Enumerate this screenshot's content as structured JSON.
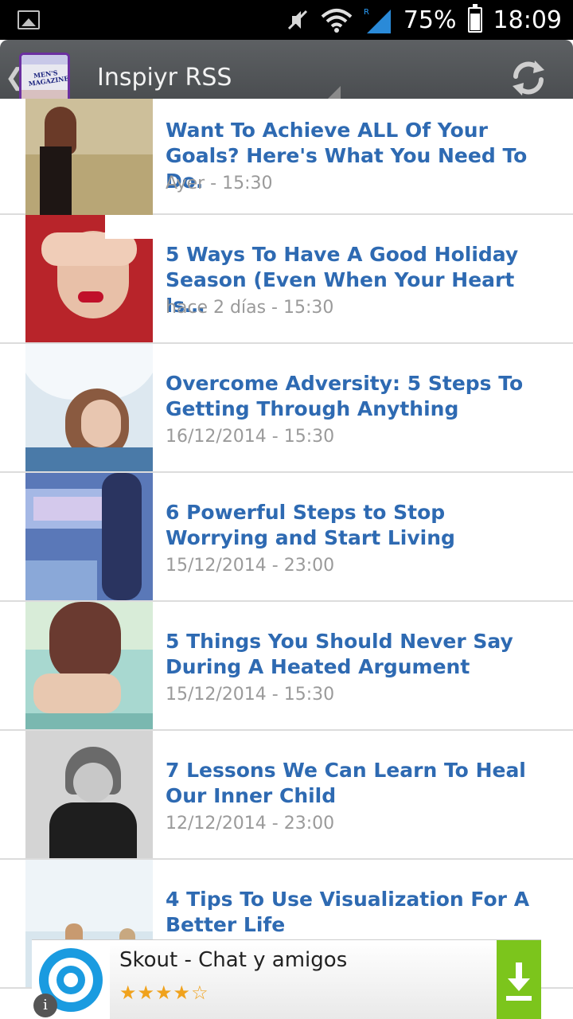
{
  "status_bar": {
    "battery_percent_text": "75%",
    "battery_level": 0.75,
    "time": "18:09",
    "icons": [
      "gallery-icon",
      "mute-icon",
      "wifi-icon",
      "signal-icon",
      "battery-icon"
    ]
  },
  "action_bar": {
    "title": "Inspiyr RSS",
    "logo_text": "MEN'S MAGAZINES",
    "icons": [
      "back-icon",
      "refresh-icon",
      "overflow-spinner-icon"
    ]
  },
  "feed": {
    "items": [
      {
        "title": "Want To Achieve ALL Of Your Goals? Here's What You Need To Do.",
        "date": "Ayer - 15:30",
        "thumb_colors": [
          "#cdbf9a",
          "#8a7b55",
          "#3a2a24"
        ]
      },
      {
        "title": "5 Ways To Have A Good Holiday Season (Even When Your Heart Is…",
        "date": "hace 2 días - 15:30",
        "thumb_colors": [
          "#c0282a",
          "#e8c0a8",
          "#ffffff"
        ]
      },
      {
        "title": "Overcome Adversity: 5 Steps To Getting Through Anything",
        "date": "16/12/2014 - 15:30",
        "thumb_colors": [
          "#cfdde8",
          "#8a5a40",
          "#2a5a8a"
        ]
      },
      {
        "title": "6 Powerful Steps to Stop Worrying and Start Living",
        "date": "15/12/2014 - 23:00",
        "thumb_colors": [
          "#4a6ab0",
          "#c0b8e0",
          "#2a3a6a"
        ]
      },
      {
        "title": "5 Things You Should Never Say During A Heated Argument",
        "date": "15/12/2014 - 15:30",
        "thumb_colors": [
          "#9ad0c8",
          "#6a3a30",
          "#e8c8b0"
        ]
      },
      {
        "title": "7 Lessons We Can Learn To Heal Our Inner Child",
        "date": "12/12/2014 - 23:00",
        "thumb_colors": [
          "#d8d8d8",
          "#2a2a2a",
          "#8a8a8a"
        ]
      },
      {
        "title": "4 Tips To Use Visualization For A Better Life",
        "date": "",
        "thumb_colors": [
          "#eef4f8",
          "#c89a70",
          "#d8e6ee"
        ]
      }
    ]
  },
  "ad": {
    "title": "Skout - Chat y amigos",
    "stars": "★★★★☆",
    "rating": 4.5,
    "icons": [
      "skout-logo-icon",
      "download-icon",
      "info-icon"
    ],
    "accent": "#7cc51c"
  }
}
